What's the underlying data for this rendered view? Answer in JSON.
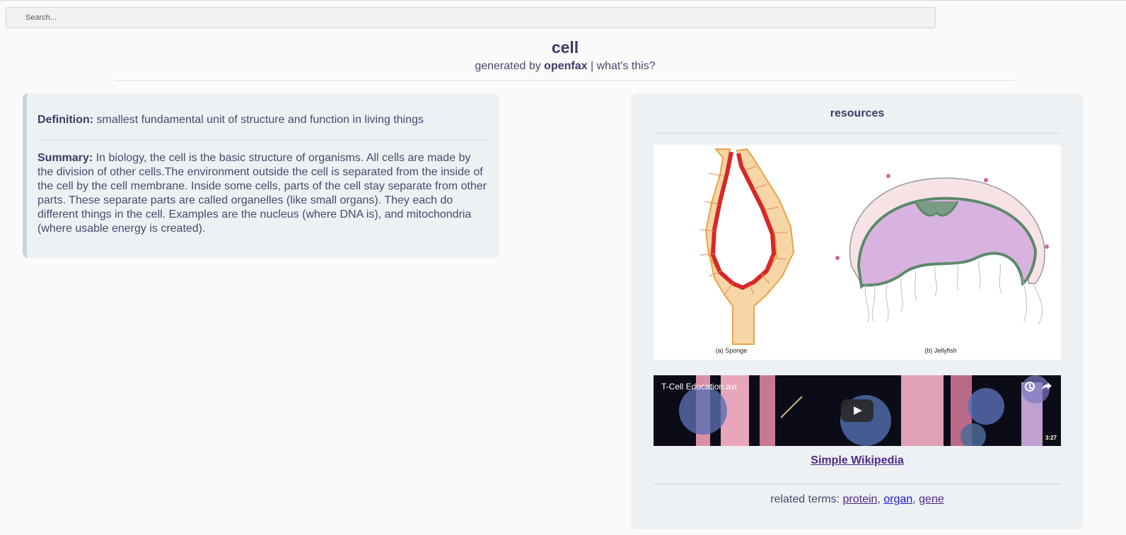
{
  "search": {
    "placeholder": "Search..."
  },
  "header": {
    "title": "cell",
    "byline_prefix": "generated by",
    "brand": "openfax",
    "separator": "|",
    "whats_this": "what's this?"
  },
  "definition": {
    "label": "Definition:",
    "text": "smallest fundamental unit of structure and function in living things"
  },
  "summary": {
    "label": "Summary:",
    "text": "In biology, the cell is the basic structure of organisms. All cells are made by the division of other cells.The environment outside the cell is separated from the inside of the cell by the cell membrane. Inside some cells, parts of the cell stay separate from other parts. These separate parts are called organelles (like small organs). They each do different things in the cell. Examples are the nucleus (where DNA is), and mitochondria (where usable energy is created)."
  },
  "resources": {
    "title": "resources",
    "figure": {
      "caption_a": "(a) Sponge",
      "caption_b": "(b) Jellyfish"
    },
    "video": {
      "title": "T-Cell Education.avi",
      "duration": "3:27"
    },
    "wiki_link": "Simple Wikipedia",
    "related_label": "related terms:",
    "related_terms": [
      "protein",
      "organ",
      "gene"
    ]
  },
  "colors": {
    "accent": "#3d3a66",
    "text": "#4a4870",
    "visited_link": "#4d2a87",
    "link": "#1a19e0",
    "card_bg": "#eef1f4"
  }
}
